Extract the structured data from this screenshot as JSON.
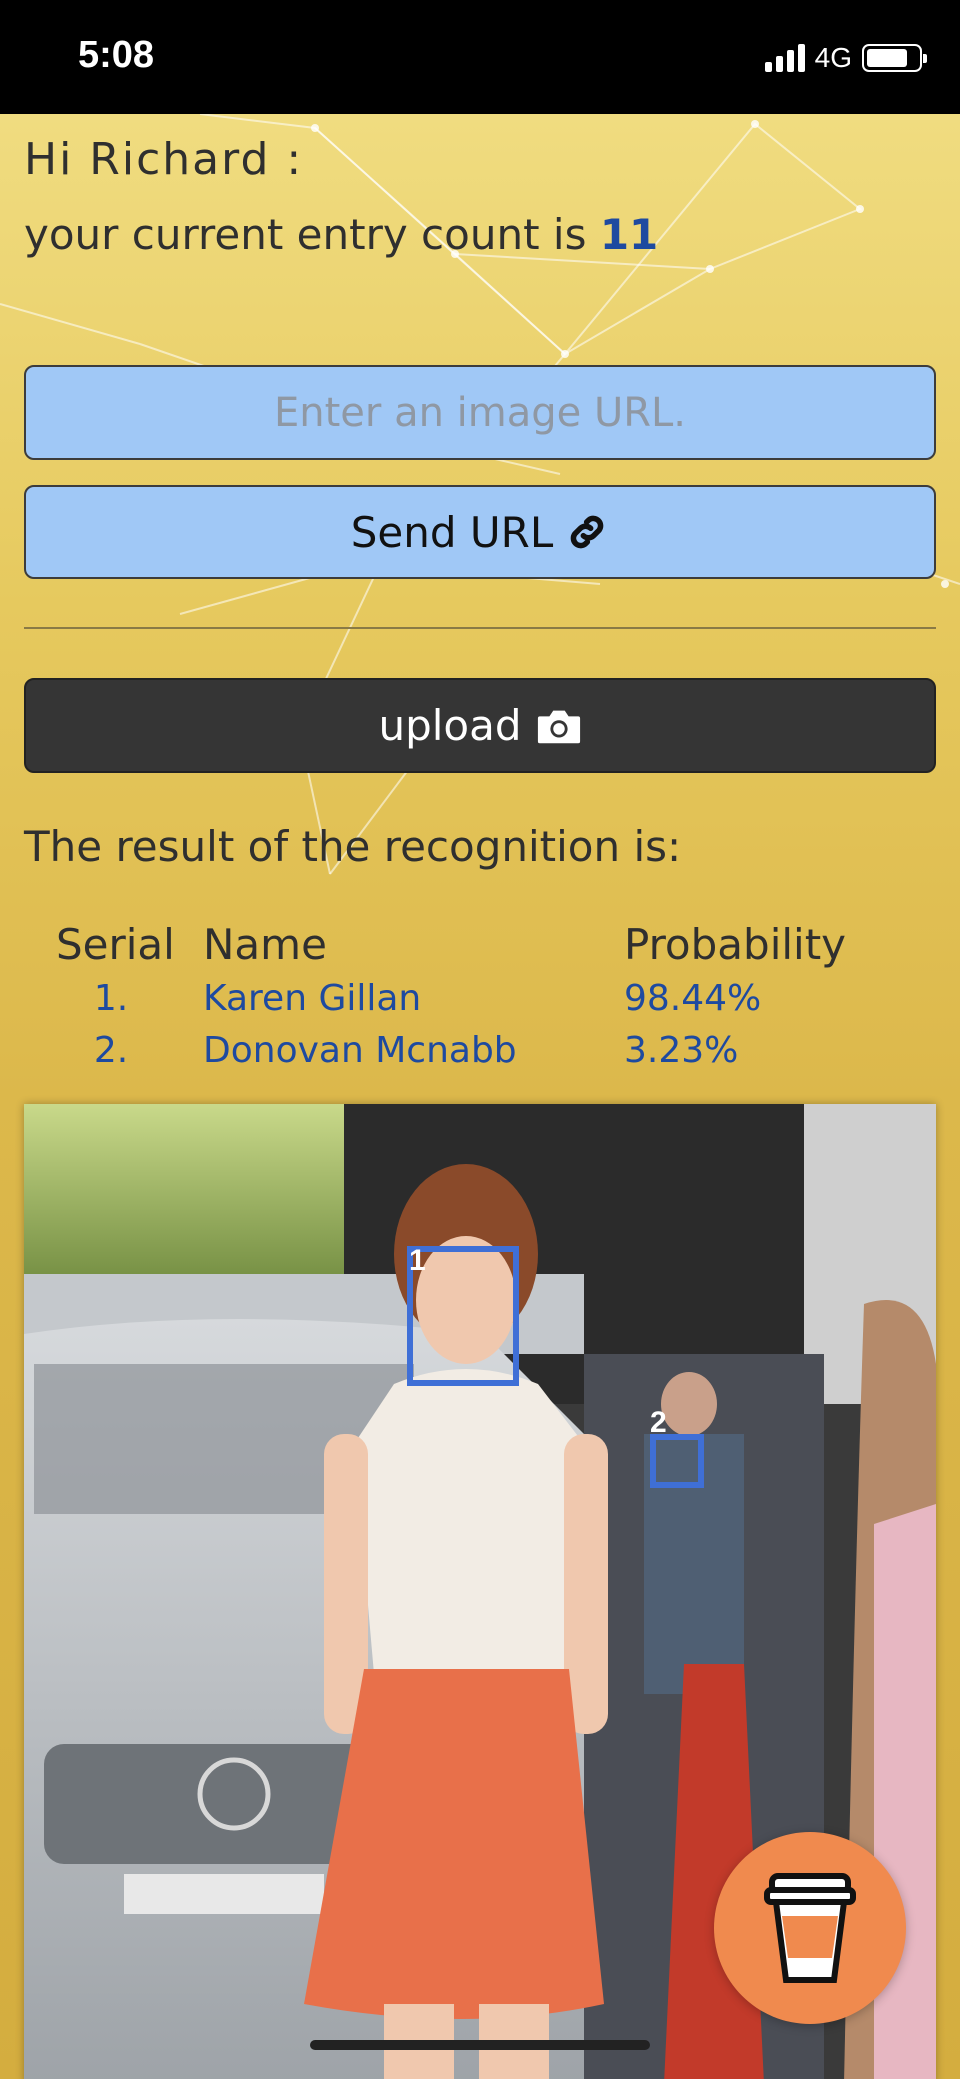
{
  "status_bar": {
    "time": "5:08",
    "network": "4G",
    "battery_level": 0.8
  },
  "greeting": {
    "text": "Hi Richard :"
  },
  "entry": {
    "prefix": "your current entry count is ",
    "count": "11"
  },
  "url_input": {
    "placeholder": "Enter an image URL.",
    "value": ""
  },
  "send_button": {
    "label": "Send URL",
    "icon": "link-icon"
  },
  "upload_button": {
    "label": "upload",
    "icon": "camera-icon"
  },
  "result": {
    "heading": "The result of the recognition is:",
    "columns": {
      "serial": "Serial",
      "name": "Name",
      "probability": "Probability"
    },
    "rows": [
      {
        "serial": "1.",
        "name": "Karen Gillan",
        "probability": "98.44%"
      },
      {
        "serial": "2.",
        "name": "Donovan Mcnabb",
        "probability": "3.23%"
      }
    ]
  },
  "photo": {
    "faces": [
      {
        "label": "1"
      },
      {
        "label": "2"
      }
    ]
  },
  "coffee_button": {
    "icon": "coffee-cup-icon"
  },
  "colors": {
    "accent_blue": "#a0c8f6",
    "link_blue": "#1e4aa0",
    "face_box": "#3f6fd6",
    "coffee_orange": "#f08a4e",
    "dark_button": "#353535"
  }
}
